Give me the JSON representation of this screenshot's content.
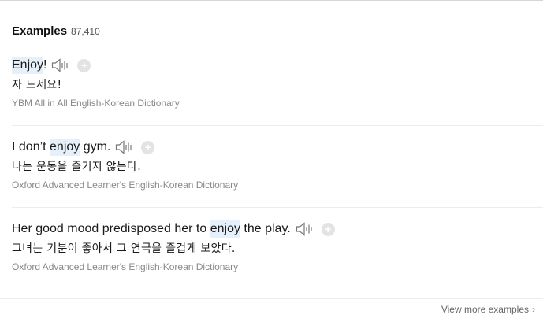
{
  "header": {
    "title": "Examples",
    "count": "87,410"
  },
  "examples": [
    {
      "pre": "",
      "hl": "Enjoy",
      "post": "!",
      "translation": "자 드세요!",
      "source": "YBM All in All English-Korean Dictionary"
    },
    {
      "pre": "I don’t ",
      "hl": "enjoy",
      "post": " gym.",
      "translation": "나는 운동을 즐기지 않는다.",
      "source": "Oxford Advanced Learner's English-Korean Dictionary"
    },
    {
      "pre": "Her good mood predisposed her to ",
      "hl": "enjoy",
      "post": " the play.",
      "translation": "그녀는 기분이 좋아서 그 연극을 즐겁게 보았다.",
      "source": "Oxford Advanced Learner's English-Korean Dictionary"
    }
  ],
  "icons": {
    "speaker": "speaker-icon",
    "add": "plus-circle-icon",
    "more": "chevron-right-icon"
  },
  "plus_glyph": "+",
  "more_link": {
    "label": "View more examples",
    "chevron": "›"
  }
}
